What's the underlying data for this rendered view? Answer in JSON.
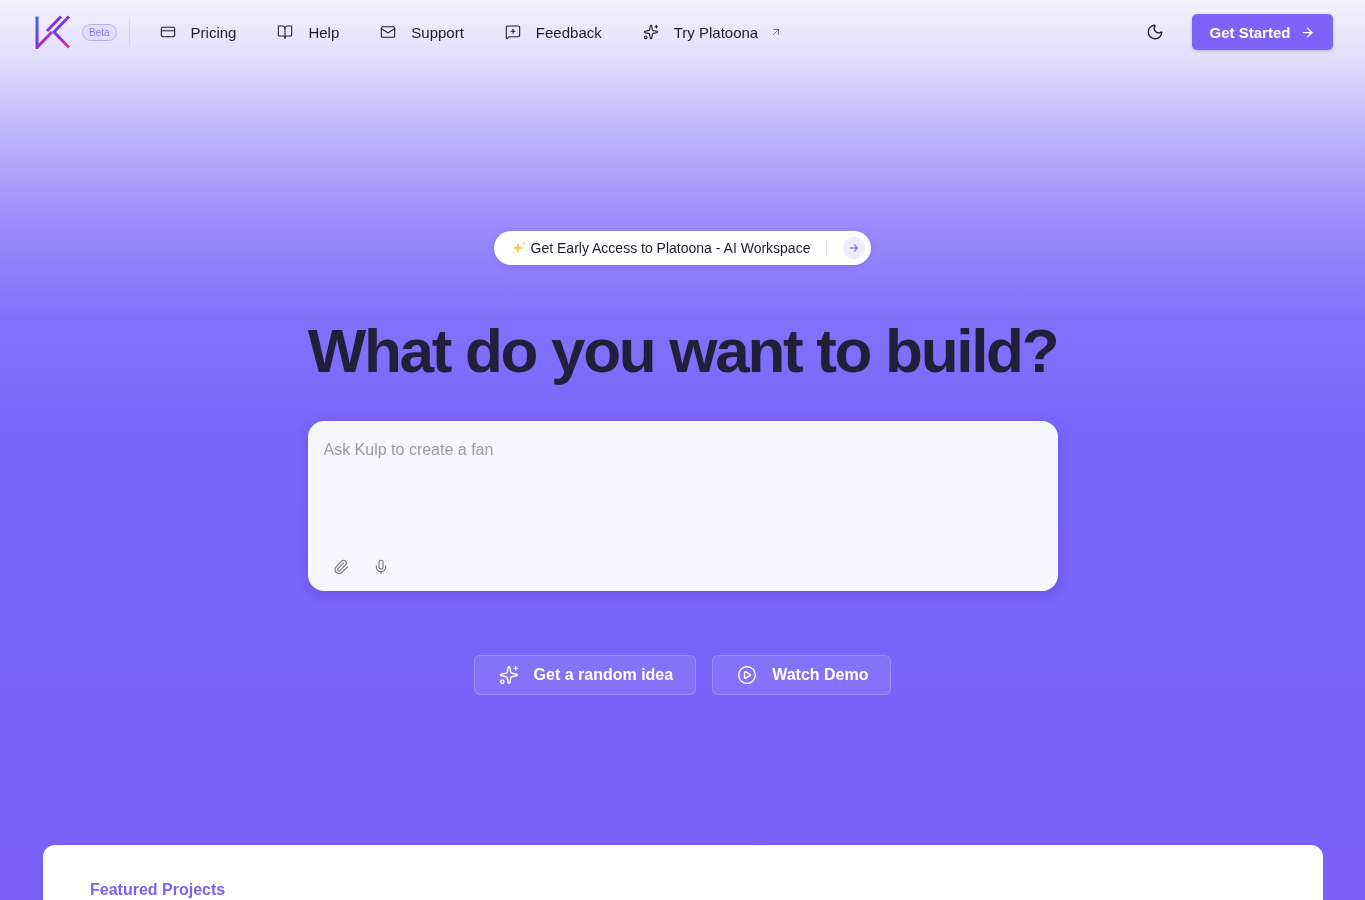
{
  "header": {
    "badge": "Beta",
    "nav": [
      {
        "label": "Pricing",
        "external": false
      },
      {
        "label": "Help",
        "external": false
      },
      {
        "label": "Support",
        "external": false
      },
      {
        "label": "Feedback",
        "external": false
      },
      {
        "label": "Try Platoona",
        "external": true
      }
    ],
    "cta": {
      "label": "Get Started"
    }
  },
  "hero": {
    "announcement": {
      "text": "Get Early Access to Platoona - AI Workspace"
    },
    "title": "What do you want to build?",
    "prompt": {
      "placeholder": "Ask Kulp to create a fan"
    },
    "actions": [
      {
        "label": "Get a random idea"
      },
      {
        "label": "Watch Demo"
      }
    ]
  },
  "featured": {
    "title": "Featured Projects"
  }
}
